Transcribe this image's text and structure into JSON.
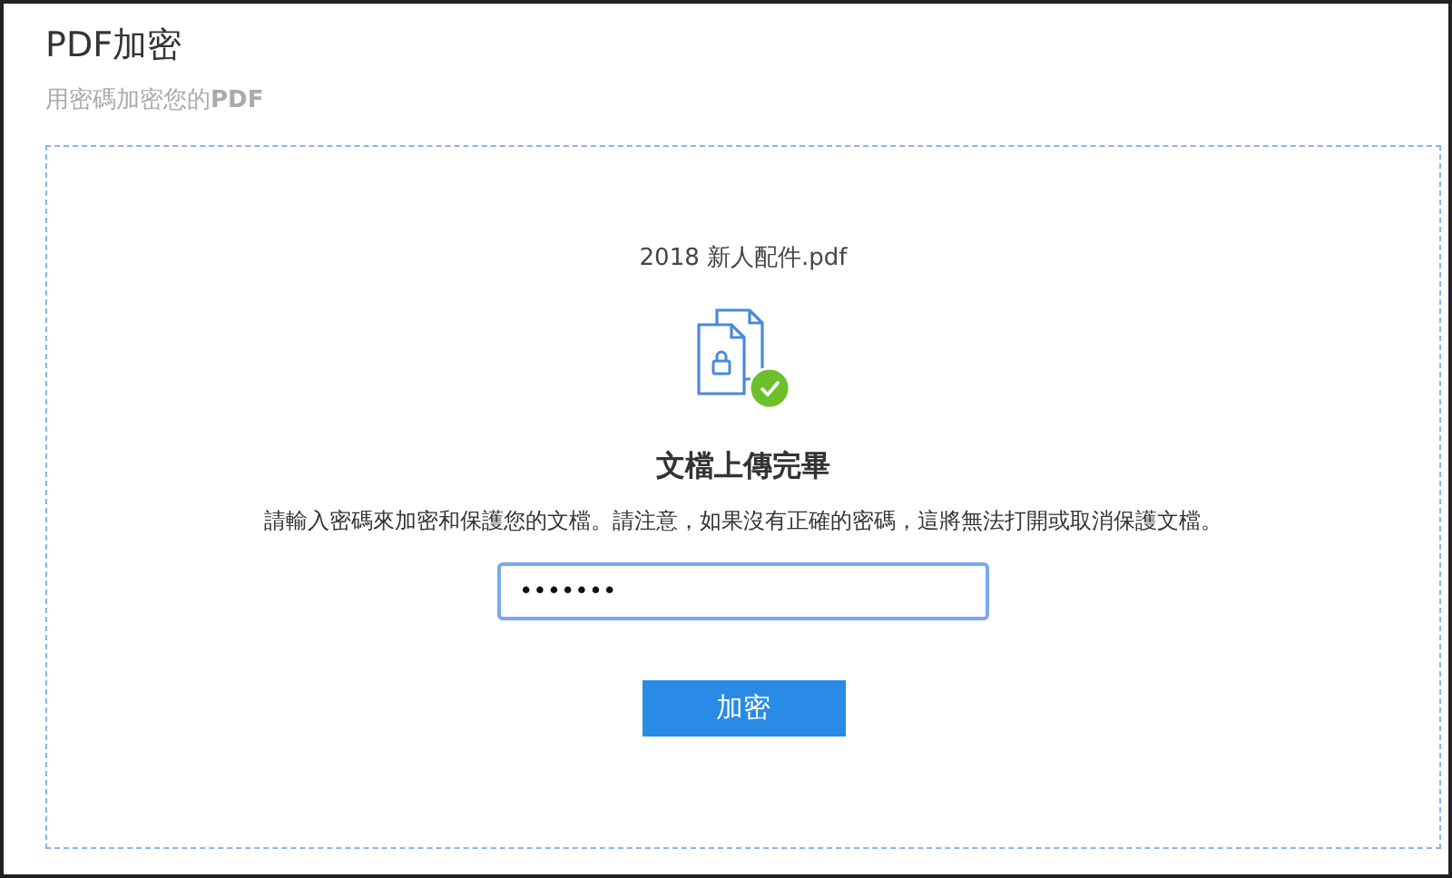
{
  "header": {
    "title": "PDF加密",
    "subtitle": "用密碼加密您的**PDF**"
  },
  "upload": {
    "file_name": "2018 新人配件.pdf",
    "status": "文檔上傳完畢",
    "uploaded": true,
    "instructions": "請輸入密碼來加密和保護您的文檔。請注意，如果沒有正確的密碼，這將無法打開或取消保護文檔。",
    "password": {
      "value": "•••••••",
      "focused": true
    },
    "button": "加密"
  }
}
